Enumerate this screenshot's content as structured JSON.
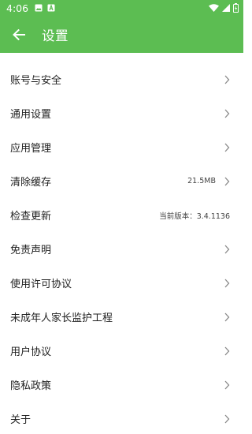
{
  "status_bar": {
    "time": "4:06",
    "icons": [
      "image-icon",
      "text-a-icon",
      "wifi-icon",
      "signal-icon",
      "battery-icon"
    ]
  },
  "app_bar": {
    "back_icon": "arrow-left-icon",
    "title": "设置"
  },
  "colors": {
    "accent": "#5cbd52"
  },
  "settings": [
    {
      "label": "账号与安全",
      "value": "",
      "chevron": true
    },
    {
      "label": "通用设置",
      "value": "",
      "chevron": true
    },
    {
      "label": "应用管理",
      "value": "",
      "chevron": true
    },
    {
      "label": "清除缓存",
      "value": "21.5MB",
      "chevron": true
    },
    {
      "label": "检查更新",
      "value": "当前版本：3.4.1136",
      "chevron": false
    },
    {
      "label": "免责声明",
      "value": "",
      "chevron": true
    },
    {
      "label": "使用许可协议",
      "value": "",
      "chevron": true
    },
    {
      "label": "未成年人家长监护工程",
      "value": "",
      "chevron": true
    },
    {
      "label": "用户协议",
      "value": "",
      "chevron": true
    },
    {
      "label": "隐私政策",
      "value": "",
      "chevron": true
    },
    {
      "label": "关于",
      "value": "",
      "chevron": true
    }
  ]
}
